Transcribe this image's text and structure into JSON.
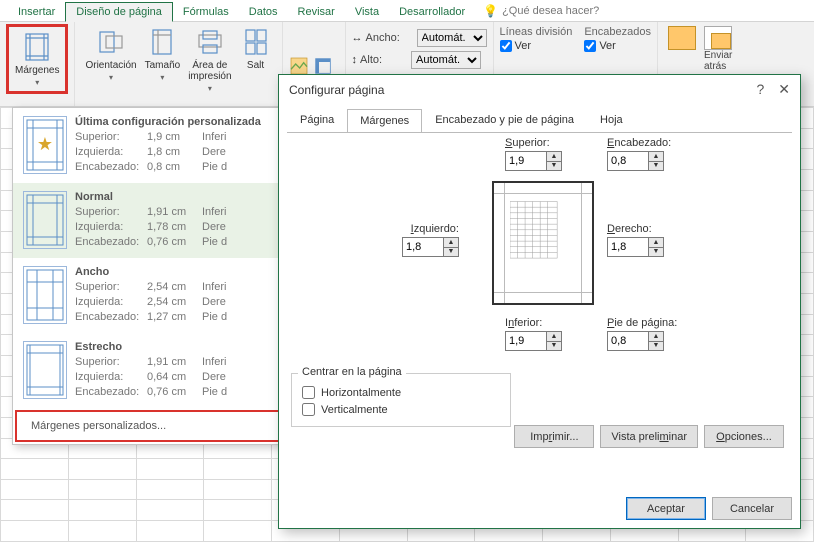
{
  "tabs": {
    "insertar": "Insertar",
    "diseno": "Diseño de página",
    "formulas": "Fórmulas",
    "datos": "Datos",
    "revisar": "Revisar",
    "vista": "Vista",
    "desarrollador": "Desarrollador",
    "tell_me": "¿Qué desea hacer?"
  },
  "ribbon": {
    "margenes": "Márgenes",
    "orientacion": "Orientación",
    "tamano": "Tamaño",
    "area": "Área de\nimpresión",
    "saltos": "Salt",
    "ancho": "Ancho:",
    "alto": "Alto:",
    "automat": "Automát.",
    "lineas_div": "Líneas división",
    "encabezados": "Encabezados",
    "ver": "Ver",
    "enviar": "Enviar\natrás"
  },
  "margins_menu": {
    "last": {
      "title": "Última configuración personalizada",
      "sup_k": "Superior:",
      "sup_v": "1,9 cm",
      "sup_k2": "Inferi",
      "izq_k": "Izquierda:",
      "izq_v": "1,8 cm",
      "izq_k2": "Dere",
      "enc_k": "Encabezado:",
      "enc_v": "0,8 cm",
      "enc_k2": "Pie d"
    },
    "normal": {
      "title": "Normal",
      "sup_k": "Superior:",
      "sup_v": "1,91 cm",
      "sup_k2": "Inferi",
      "izq_k": "Izquierda:",
      "izq_v": "1,78 cm",
      "izq_k2": "Dere",
      "enc_k": "Encabezado:",
      "enc_v": "0,76 cm",
      "enc_k2": "Pie d"
    },
    "ancho": {
      "title": "Ancho",
      "sup_k": "Superior:",
      "sup_v": "2,54 cm",
      "sup_k2": "Inferi",
      "izq_k": "Izquierda:",
      "izq_v": "2,54 cm",
      "izq_k2": "Dere",
      "enc_k": "Encabezado:",
      "enc_v": "1,27 cm",
      "enc_k2": "Pie d"
    },
    "estrecho": {
      "title": "Estrecho",
      "sup_k": "Superior:",
      "sup_v": "1,91 cm",
      "sup_k2": "Inferi",
      "izq_k": "Izquierda:",
      "izq_v": "0,64 cm",
      "izq_k2": "Dere",
      "enc_k": "Encabezado:",
      "enc_v": "0,76 cm",
      "enc_k2": "Pie d"
    },
    "custom": "Márgenes personalizados..."
  },
  "dialog": {
    "title": "Configurar página",
    "tab_pagina": "Página",
    "tab_margenes": "Márgenes",
    "tab_encpie": "Encabezado y pie de página",
    "tab_hoja": "Hoja",
    "superior_lbl": "Superior:",
    "superior_val": "1,9",
    "encabezado_lbl": "Encabezado:",
    "encabezado_val": "0,8",
    "izquierdo_lbl": "Izquierdo:",
    "izquierdo_val": "1,8",
    "derecho_lbl": "Derecho:",
    "derecho_val": "1,8",
    "inferior_lbl": "Inferior:",
    "inferior_val": "1,9",
    "pie_lbl": "Pie de página:",
    "pie_val": "0,8",
    "centrar_legend": "Centrar en la página",
    "horiz": "Horizontalmente",
    "vert": "Verticalmente",
    "imprimir": "Imprimir...",
    "vista_prelim": "Vista preliminar",
    "opciones": "Opciones...",
    "aceptar": "Aceptar",
    "cancelar": "Cancelar"
  }
}
